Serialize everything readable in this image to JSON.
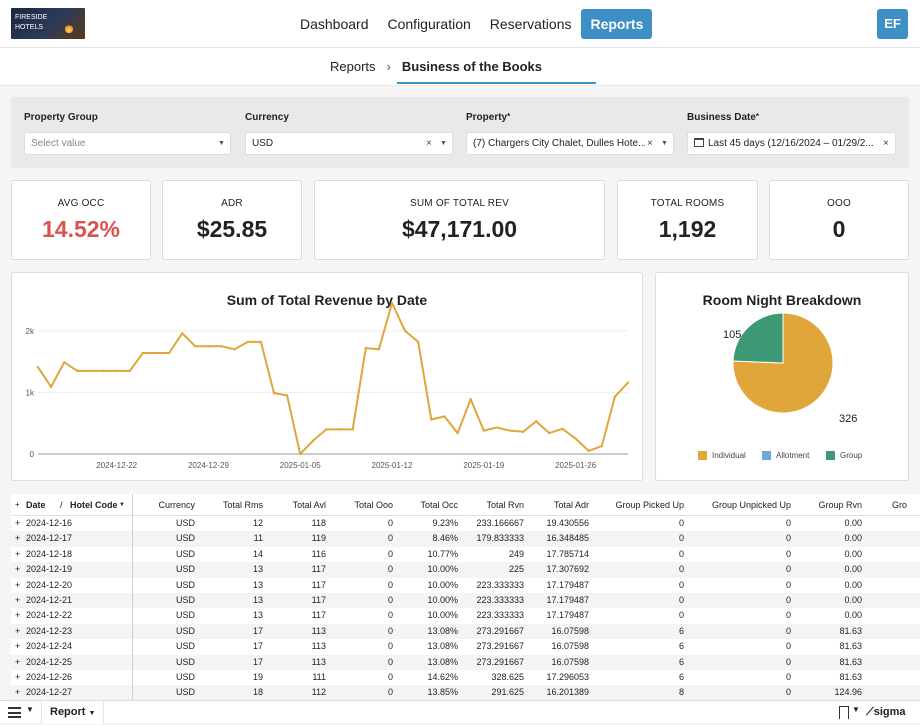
{
  "app": {
    "logo_line1": "FIRESIDE",
    "logo_line2": "HOTELS",
    "nav": [
      "Dashboard",
      "Configuration",
      "Reservations",
      "Reports"
    ],
    "active_nav": "Reports",
    "avatar": "EF",
    "accent_color": "#3f8fc7"
  },
  "breadcrumb": {
    "root": "Reports",
    "sep": "›",
    "current": "Business of the Books"
  },
  "filters": {
    "property_group": {
      "label": "Property Group",
      "placeholder": "Select value"
    },
    "currency": {
      "label": "Currency",
      "value": "USD"
    },
    "property": {
      "label": "Property",
      "value": "(7) Chargers City Chalet, Dulles Hote..."
    },
    "business_date": {
      "label": "Business Date",
      "value": "Last 45 days (12/16/2024 – 01/29/2..."
    }
  },
  "kpis": {
    "avg_occ": {
      "label": "AVG OCC",
      "value": "14.52%",
      "color": "#d9534f"
    },
    "adr": {
      "label": "ADR",
      "value": "$25.85"
    },
    "total_rev": {
      "label": "SUM OF TOTAL REV",
      "value": "$47,171.00"
    },
    "total_rooms": {
      "label": "TOTAL ROOMS",
      "value": "1,192"
    },
    "ooo": {
      "label": "OOO",
      "value": "0"
    }
  },
  "chart_data": [
    {
      "type": "line",
      "title": "Sum of Total Revenue by Date",
      "y_tick_labels": [
        "0",
        "1k",
        "2k"
      ],
      "ylim": [
        0,
        2550
      ],
      "x_tick_labels": [
        "2024-12-22",
        "2024-12-29",
        "2025-01-05",
        "2025-01-12",
        "2025-01-19",
        "2025-01-26"
      ],
      "x_start": "2024-12-16",
      "color": "#e0a63a",
      "values": [
        1410,
        1090,
        1490,
        1350,
        1350,
        1350,
        1350,
        1350,
        1640,
        1640,
        1640,
        1960,
        1750,
        1750,
        1750,
        1700,
        1820,
        1820,
        990,
        950,
        0,
        220,
        400,
        400,
        400,
        1720,
        1700,
        2450,
        2000,
        1820,
        560,
        610,
        340,
        890,
        380,
        430,
        380,
        360,
        530,
        340,
        410,
        250,
        50,
        130,
        930,
        1160
      ]
    },
    {
      "type": "pie",
      "title": "Room Night Breakdown",
      "categories": [
        "Individual",
        "Allotment",
        "Group"
      ],
      "values": [
        326,
        0,
        105
      ],
      "colors": [
        "#e0a63a",
        "#6fa8dc",
        "#3e9a76"
      ],
      "data_labels": [
        "326",
        "105"
      ]
    }
  ],
  "table": {
    "columns": [
      "Date",
      "Hotel Code",
      "Currency",
      "Total Rms",
      "Total Avl",
      "Total Ooo",
      "Total Occ",
      "Total Rvn",
      "Total Adr",
      "Group Picked Up",
      "Group Unpicked Up",
      "Group Rvn",
      "Gro"
    ],
    "rows": [
      [
        "2024-12-16",
        "USD",
        "12",
        "118",
        "0",
        "9.23%",
        "233.166667",
        "19.430556",
        "0",
        "0",
        "0.00"
      ],
      [
        "2024-12-17",
        "USD",
        "11",
        "119",
        "0",
        "8.46%",
        "179.833333",
        "16.348485",
        "0",
        "0",
        "0.00"
      ],
      [
        "2024-12-18",
        "USD",
        "14",
        "116",
        "0",
        "10.77%",
        "249",
        "17.785714",
        "0",
        "0",
        "0.00"
      ],
      [
        "2024-12-19",
        "USD",
        "13",
        "117",
        "0",
        "10.00%",
        "225",
        "17.307692",
        "0",
        "0",
        "0.00"
      ],
      [
        "2024-12-20",
        "USD",
        "13",
        "117",
        "0",
        "10.00%",
        "223.333333",
        "17.179487",
        "0",
        "0",
        "0.00"
      ],
      [
        "2024-12-21",
        "USD",
        "13",
        "117",
        "0",
        "10.00%",
        "223.333333",
        "17.179487",
        "0",
        "0",
        "0.00"
      ],
      [
        "2024-12-22",
        "USD",
        "13",
        "117",
        "0",
        "10.00%",
        "223.333333",
        "17.179487",
        "0",
        "0",
        "0.00"
      ],
      [
        "2024-12-23",
        "USD",
        "17",
        "113",
        "0",
        "13.08%",
        "273.291667",
        "16.07598",
        "6",
        "0",
        "81.63"
      ],
      [
        "2024-12-24",
        "USD",
        "17",
        "113",
        "0",
        "13.08%",
        "273.291667",
        "16.07598",
        "6",
        "0",
        "81.63"
      ],
      [
        "2024-12-25",
        "USD",
        "17",
        "113",
        "0",
        "13.08%",
        "273.291667",
        "16.07598",
        "6",
        "0",
        "81.63"
      ],
      [
        "2024-12-26",
        "USD",
        "19",
        "111",
        "0",
        "14.62%",
        "328.625",
        "17.296053",
        "6",
        "0",
        "81.63"
      ],
      [
        "2024-12-27",
        "USD",
        "18",
        "112",
        "0",
        "13.85%",
        "291.625",
        "16.201389",
        "8",
        "0",
        "124.96"
      ]
    ]
  },
  "bottom": {
    "page_tab": "Report",
    "brand": "sigma"
  }
}
